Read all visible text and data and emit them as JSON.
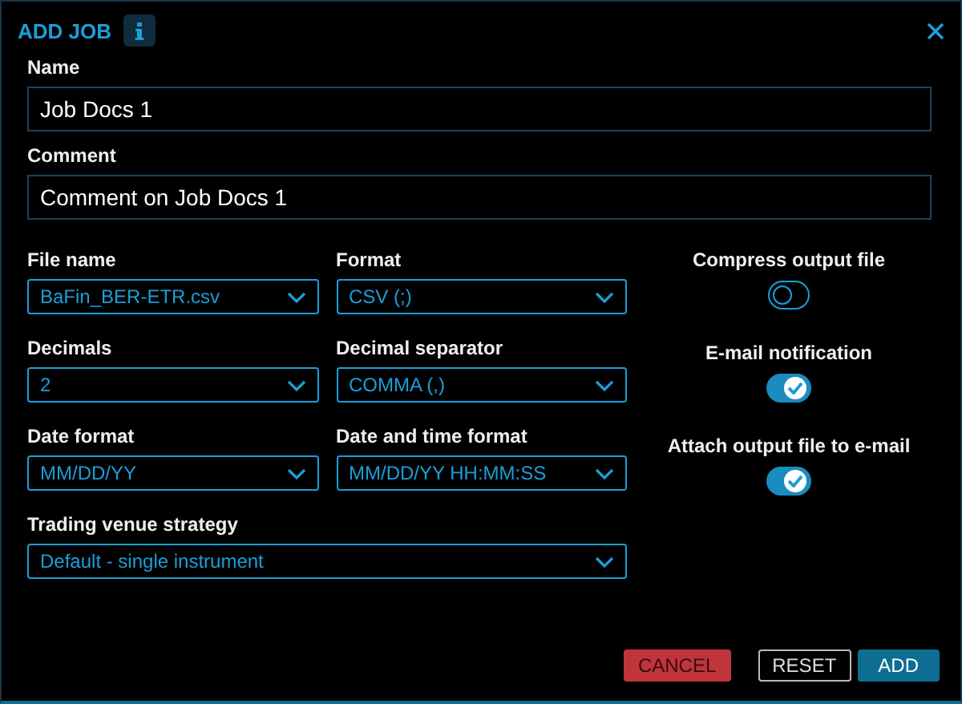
{
  "dialog": {
    "title": "ADD JOB"
  },
  "text_fields": [
    {
      "label": "Name",
      "value": "Job Docs 1"
    },
    {
      "label": "Comment",
      "value": "Comment on Job Docs 1"
    }
  ],
  "dropdown_rows": [
    [
      {
        "label": "File name",
        "value": "BaFin_BER-ETR.csv"
      },
      {
        "label": "Format",
        "value": "CSV (;)"
      }
    ],
    [
      {
        "label": "Decimals",
        "value": "2"
      },
      {
        "label": "Decimal separator",
        "value": "COMMA (,)"
      }
    ],
    [
      {
        "label": "Date format",
        "value": "MM/DD/YY"
      },
      {
        "label": "Date and time format",
        "value": "MM/DD/YY HH:MM:SS"
      }
    ],
    [
      {
        "label": "Trading venue strategy",
        "value": "Default - single instrument"
      }
    ]
  ],
  "toggles": [
    {
      "label": "Compress output file",
      "on": false
    },
    {
      "label": "E-mail notification",
      "on": true
    },
    {
      "label": "Attach output file to e-mail",
      "on": true
    }
  ],
  "buttons": [
    {
      "label": "CANCEL",
      "kind": "cancel"
    },
    {
      "label": "RESET",
      "kind": "reset"
    },
    {
      "label": "ADD",
      "kind": "submit"
    }
  ]
}
